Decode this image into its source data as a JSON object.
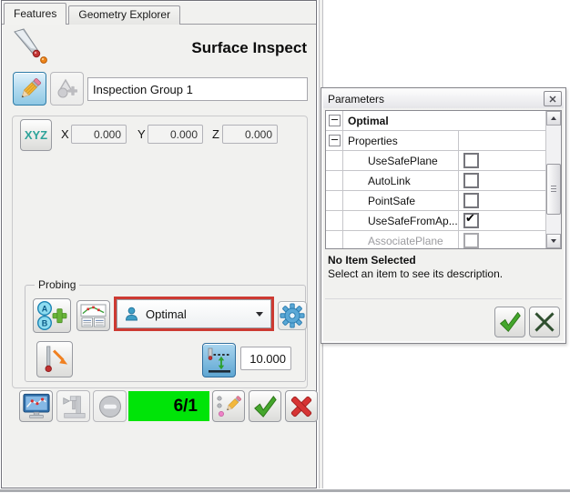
{
  "colors": {
    "highlight_red": "#cd3a32",
    "status_green": "#00e408",
    "confirm_green": "#44a62c",
    "cancel_red": "#d63434",
    "accent_blue": "#2d7ca8"
  },
  "tabs": [
    {
      "label": "Features",
      "active": true
    },
    {
      "label": "Geometry Explorer",
      "active": false
    }
  ],
  "header": {
    "title": "Surface Inspect"
  },
  "name_field": {
    "value": "Inspection Group 1"
  },
  "coords": {
    "button_label": "XYZ",
    "fields": [
      {
        "label": "X",
        "value": "0.000"
      },
      {
        "label": "Y",
        "value": "0.000"
      },
      {
        "label": "Z",
        "value": "0.000"
      }
    ]
  },
  "probing": {
    "label": "Probing",
    "strategy": {
      "value": "Optimal"
    },
    "depth": {
      "value": "10.000"
    }
  },
  "status": {
    "counter": "6/1"
  },
  "parameters": {
    "title": "Parameters",
    "rows": [
      {
        "label": "Optimal"
      },
      {
        "label": "Properties"
      },
      {
        "label": "UseSafePlane",
        "checked": false
      },
      {
        "label": "AutoLink",
        "checked": false
      },
      {
        "label": "PointSafe",
        "checked": false
      },
      {
        "label": "UseSafeFromAp...",
        "checked": true
      },
      {
        "label": "AssociatePlane",
        "checked": false,
        "disabled": true
      }
    ],
    "description": {
      "title": "No Item Selected",
      "text": "Select an item to see its description."
    }
  }
}
